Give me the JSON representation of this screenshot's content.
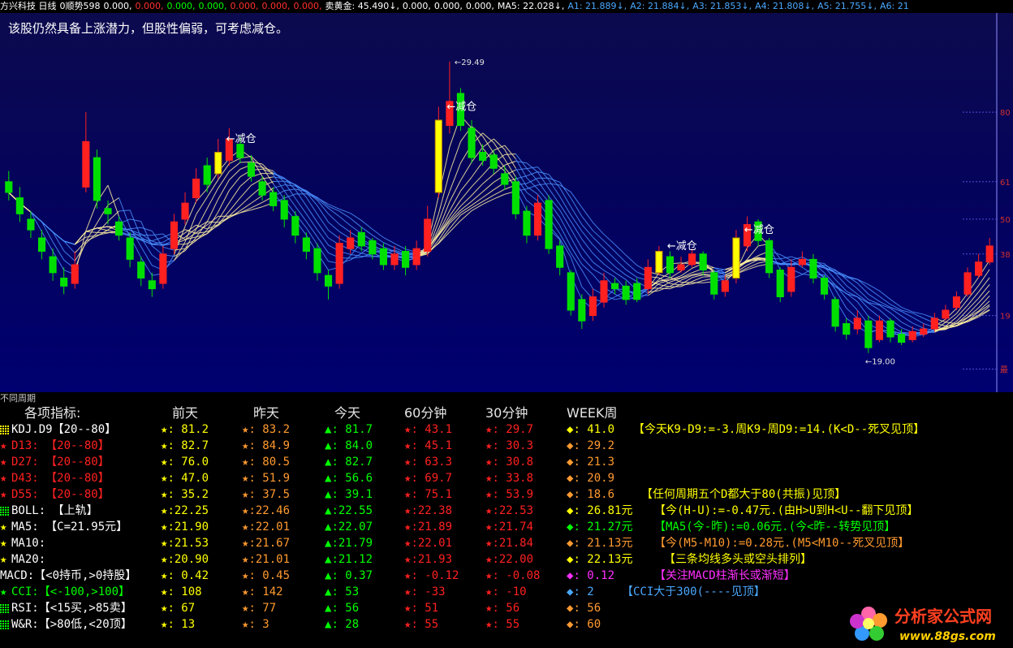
{
  "topbar": {
    "items": [
      {
        "text": "方兴科技 日线",
        "color": "#ffffff"
      },
      {
        "text": "0顺势598",
        "color": "#ffffff"
      },
      {
        "text": "0.000,",
        "color": "#ffffff"
      },
      {
        "text": "0.000,",
        "color": "#ff3030"
      },
      {
        "text": "0.000,",
        "color": "#00ff00"
      },
      {
        "text": "0.000,",
        "color": "#00ff00"
      },
      {
        "text": "0.000,",
        "color": "#ff3030"
      },
      {
        "text": "0.000,",
        "color": "#ff3030"
      },
      {
        "text": "0.000,",
        "color": "#ff3030"
      },
      {
        "text": "卖黄金: 45.490↓,",
        "color": "#ffffff"
      },
      {
        "text": "0.000,",
        "color": "#ffffff"
      },
      {
        "text": "0.000,",
        "color": "#ffffff"
      },
      {
        "text": "0.000,",
        "color": "#ffffff"
      },
      {
        "text": "MA5: 22.028↓,",
        "color": "#ffffff"
      },
      {
        "text": "A1: 21.889↓,",
        "color": "#4aa8ff"
      },
      {
        "text": "A2: 21.884↓,",
        "color": "#4aa8ff"
      },
      {
        "text": "A3: 21.853↓,",
        "color": "#4aa8ff"
      },
      {
        "text": "A4: 21.808↓,",
        "color": "#4aa8ff"
      },
      {
        "text": "A5: 21.755↓,",
        "color": "#4aa8ff"
      },
      {
        "text": "A6: 21",
        "color": "#4aa8ff"
      }
    ]
  },
  "chart_data": {
    "type": "candlestick",
    "title": "方兴科技 日线",
    "annotation": "该股仍然具备上涨潜力，但股性偏弱，可考虑减仓。",
    "signal_label": "←减仓",
    "signals_at_index": [
      19,
      39,
      59,
      66
    ],
    "max_label": "←29.49",
    "min_label": "←19.00",
    "y_axis_labels": [
      "80",
      "61",
      "50",
      "38",
      "19",
      "最"
    ],
    "ylim": [
      17.5,
      31.0
    ],
    "close": [
      24.6,
      23.8,
      23.2,
      22.4,
      21.6,
      21.1,
      21.9,
      26.5,
      24.3,
      23.8,
      23.0,
      22.1,
      21.4,
      21.0,
      22.3,
      23.5,
      24.2,
      25.1,
      24.9,
      26.1,
      26.6,
      25.9,
      25.2,
      24.5,
      24.1,
      23.6,
      23.0,
      22.4,
      21.6,
      21.1,
      22.7,
      22.9,
      22.6,
      22.3,
      21.9,
      22.3,
      21.8,
      22.5,
      23.6,
      27.3,
      28.0,
      27.1,
      25.9,
      25.8,
      25.5,
      24.9,
      23.8,
      23.0,
      24.2,
      22.5,
      21.8,
      20.2,
      19.8,
      20.7,
      21.3,
      21.0,
      20.6,
      20.6,
      21.8,
      22.4,
      21.6,
      21.9,
      22.3,
      21.7,
      20.8,
      21.3,
      22.9,
      23.4,
      22.8,
      21.6,
      20.7,
      21.8,
      22.1,
      21.4,
      20.8,
      19.6,
      19.3,
      19.9,
      18.8,
      19.8,
      19.2,
      19.0,
      19.4,
      19.5,
      19.9,
      20.2,
      20.7,
      21.6,
      22.0,
      22.6
    ],
    "open": [
      25.0,
      24.4,
      23.6,
      22.9,
      22.2,
      21.4,
      21.2,
      24.8,
      25.9,
      24.0,
      23.5,
      22.9,
      22.0,
      21.3,
      21.2,
      22.5,
      23.6,
      24.4,
      25.6,
      25.3,
      25.8,
      26.4,
      25.7,
      25.0,
      24.6,
      24.3,
      23.7,
      22.9,
      22.5,
      21.5,
      21.2,
      22.5,
      23.1,
      22.8,
      22.5,
      21.9,
      22.4,
      21.9,
      22.4,
      24.6,
      27.1,
      28.3,
      27.0,
      26.1,
      26.0,
      25.3,
      25.0,
      23.9,
      23.0,
      24.3,
      22.6,
      21.6,
      20.6,
      20.0,
      20.5,
      21.2,
      21.1,
      21.2,
      21.0,
      21.6,
      22.2,
      21.7,
      21.9,
      22.3,
      21.6,
      20.9,
      21.4,
      22.6,
      23.5,
      22.8,
      21.7,
      20.9,
      21.9,
      22.1,
      21.4,
      20.6,
      19.7,
      19.5,
      19.8,
      19.1,
      19.8,
      19.3,
      19.1,
      19.3,
      19.5,
      19.9,
      20.3,
      20.8,
      21.5,
      22.0
    ],
    "high": [
      25.4,
      24.8,
      23.9,
      23.2,
      22.5,
      21.8,
      22.4,
      27.6,
      26.2,
      24.3,
      23.7,
      23.1,
      22.2,
      21.6,
      22.6,
      23.8,
      24.6,
      25.5,
      25.9,
      26.6,
      27.0,
      26.7,
      26.0,
      25.2,
      24.8,
      24.5,
      23.9,
      23.1,
      22.7,
      21.7,
      23.0,
      23.2,
      23.3,
      22.9,
      22.7,
      22.6,
      22.6,
      22.8,
      24.1,
      27.8,
      29.49,
      28.5,
      27.3,
      26.4,
      26.2,
      25.6,
      25.2,
      24.1,
      24.5,
      24.5,
      22.8,
      21.7,
      20.8,
      21.0,
      21.6,
      21.4,
      21.3,
      21.4,
      22.1,
      22.6,
      22.4,
      22.2,
      22.5,
      22.4,
      21.7,
      21.5,
      23.2,
      23.7,
      23.6,
      22.9,
      21.8,
      22.1,
      22.4,
      22.3,
      21.5,
      20.7,
      19.9,
      20.2,
      20.0,
      20.0,
      19.9,
      19.5,
      19.6,
      19.7,
      20.1,
      20.4,
      20.9,
      21.8,
      22.3,
      22.9
    ],
    "low": [
      24.3,
      23.5,
      22.9,
      22.1,
      21.3,
      20.8,
      21.0,
      24.6,
      24.0,
      23.4,
      22.8,
      21.8,
      21.1,
      20.7,
      21.0,
      22.3,
      23.4,
      24.2,
      24.6,
      25.1,
      25.6,
      25.7,
      25.0,
      24.3,
      23.9,
      23.3,
      22.7,
      22.1,
      21.3,
      20.6,
      21.0,
      22.3,
      22.4,
      22.1,
      21.7,
      21.7,
      21.5,
      21.7,
      22.2,
      24.4,
      26.8,
      26.9,
      25.7,
      25.6,
      25.3,
      24.7,
      23.6,
      22.7,
      22.8,
      22.3,
      21.5,
      20.0,
      19.5,
      19.8,
      20.3,
      20.8,
      20.4,
      20.5,
      20.8,
      21.5,
      21.4,
      21.6,
      21.8,
      21.5,
      20.6,
      20.7,
      21.2,
      22.4,
      22.6,
      21.4,
      20.5,
      20.7,
      21.8,
      21.2,
      20.6,
      19.4,
      19.1,
      19.3,
      18.6,
      19.0,
      19.0,
      18.9,
      19.0,
      19.2,
      19.4,
      19.8,
      20.2,
      20.7,
      21.4,
      21.9
    ]
  },
  "panel": {
    "title": "不同周期",
    "headers": [
      "各项指标:",
      "前天",
      "昨天",
      "今天",
      "60分钟",
      "30分钟",
      "WEEK周"
    ],
    "rows": [
      {
        "ind": "KDJ.D9【20--80】",
        "ind_icon": "grid",
        "ind_color": "#ffff00",
        "vals": [
          [
            "★",
            "#ffff00",
            ": 81.2"
          ],
          [
            "★",
            "#ff9a30",
            ": 83.2"
          ],
          [
            "▲",
            "#00ff00",
            ": 81.7"
          ],
          [
            "★",
            "#ff2020",
            ": 43.1"
          ],
          [
            "★",
            "#ff2020",
            ": 29.7"
          ],
          [
            "◆",
            "#ffff00",
            ": 41.0"
          ]
        ],
        "note": "【今天K9-D9:=-3.周K9-周D9:=14.(K<D--死叉见顶】",
        "note_color": "#ffff00"
      },
      {
        "ind": "D13: 【20--80】",
        "ind_icon": "★",
        "ind_color": "#ff2020",
        "vals": [
          [
            "★",
            "#ffff00",
            ": 82.7"
          ],
          [
            "★",
            "#ff9a30",
            ": 84.9"
          ],
          [
            "▲",
            "#00ff00",
            ": 84.0"
          ],
          [
            "★",
            "#ff2020",
            ": 45.1"
          ],
          [
            "★",
            "#ff2020",
            ": 30.3"
          ],
          [
            "◆",
            "#ff9a30",
            ": 29.2"
          ]
        ],
        "note": "",
        "note_color": "#ffff00"
      },
      {
        "ind": "D27: 【20--80】",
        "ind_icon": "★",
        "ind_color": "#ff2020",
        "vals": [
          [
            "★",
            "#ffff00",
            ": 76.0"
          ],
          [
            "★",
            "#ff9a30",
            ": 80.5"
          ],
          [
            "▲",
            "#00ff00",
            ": 82.7"
          ],
          [
            "★",
            "#ff2020",
            ": 63.3"
          ],
          [
            "★",
            "#ff2020",
            ": 30.8"
          ],
          [
            "◆",
            "#ff9a30",
            ": 21.3"
          ]
        ],
        "note": "",
        "note_color": "#ffff00"
      },
      {
        "ind": "D43: 【20--80】",
        "ind_icon": "★",
        "ind_color": "#ff2020",
        "vals": [
          [
            "★",
            "#ffff00",
            ": 47.0"
          ],
          [
            "★",
            "#ff9a30",
            ": 51.9"
          ],
          [
            "▲",
            "#00ff00",
            ": 56.6"
          ],
          [
            "★",
            "#ff2020",
            ": 69.7"
          ],
          [
            "★",
            "#ff2020",
            ": 33.8"
          ],
          [
            "◆",
            "#ff9a30",
            ": 20.9"
          ]
        ],
        "note": "",
        "note_color": "#ffff00"
      },
      {
        "ind": "D55: 【20--80】",
        "ind_icon": "★",
        "ind_color": "#ff2020",
        "vals": [
          [
            "★",
            "#ffff00",
            ": 35.2"
          ],
          [
            "★",
            "#ff9a30",
            ": 37.5"
          ],
          [
            "▲",
            "#00ff00",
            ": 39.1"
          ],
          [
            "★",
            "#ff2020",
            ": 75.1"
          ],
          [
            "★",
            "#ff2020",
            ": 53.9"
          ],
          [
            "◆",
            "#ff9a30",
            ": 18.6"
          ]
        ],
        "note": "【任何周期五个D都大于80(共振)见顶】",
        "note_color": "#ffff00"
      },
      {
        "ind": "BOLL: 【上轨】",
        "ind_icon": "grid",
        "ind_color": "#00ff00",
        "vals": [
          [
            "★",
            "#ffff00",
            ":22.25"
          ],
          [
            "★",
            "#ff9a30",
            ":22.46"
          ],
          [
            "▲",
            "#00ff00",
            ":22.55"
          ],
          [
            "★",
            "#ff2020",
            ":22.38"
          ],
          [
            "★",
            "#ff2020",
            ":22.53"
          ],
          [
            "◆",
            "#ffff00",
            ": 26.81元"
          ]
        ],
        "note": "【今(H-U):=-0.47元.(由H>U到H<U--翻下见顶】",
        "note_color": "#ffff00"
      },
      {
        "ind": "MA5: 【C=21.95元】",
        "ind_icon": "★",
        "ind_color": "#ffff00",
        "vals": [
          [
            "★",
            "#ffff00",
            ":21.90"
          ],
          [
            "★",
            "#ff9a30",
            ":22.01"
          ],
          [
            "▲",
            "#00ff00",
            ":22.07"
          ],
          [
            "★",
            "#ff2020",
            ":21.89"
          ],
          [
            "★",
            "#ff2020",
            ":21.74"
          ],
          [
            "◆",
            "#00ff00",
            ": 21.27元"
          ]
        ],
        "note": "【MA5(今-昨):=0.06元.(今<昨--转势见顶】",
        "note_color": "#00ff00"
      },
      {
        "ind": "MA10:",
        "ind_icon": "★",
        "ind_color": "#ffff00",
        "vals": [
          [
            "★",
            "#ffff00",
            ":21.53"
          ],
          [
            "★",
            "#ff9a30",
            ":21.67"
          ],
          [
            "▲",
            "#00ff00",
            ":21.79"
          ],
          [
            "★",
            "#ff2020",
            ":22.01"
          ],
          [
            "★",
            "#ff2020",
            ":21.84"
          ],
          [
            "◆",
            "#ff9a30",
            ": 21.13元"
          ]
        ],
        "note": "【今(M5-M10):=0.28元.(M5<M10--死叉见顶】",
        "note_color": "#ff9a30"
      },
      {
        "ind": "MA20:",
        "ind_icon": "★",
        "ind_color": "#ffff00",
        "vals": [
          [
            "★",
            "#ffff00",
            ":20.90"
          ],
          [
            "★",
            "#ff9a30",
            ":21.01"
          ],
          [
            "▲",
            "#00ff00",
            ":21.12"
          ],
          [
            "★",
            "#ff2020",
            ":21.93"
          ],
          [
            "★",
            "#ff2020",
            ":22.00"
          ],
          [
            "◆",
            "#ffff00",
            ": 22.13元"
          ]
        ],
        "note": "【三条均线多头或空头排列】",
        "note_color": "#ffff00"
      },
      {
        "ind": "MACD:【<0持币,>0持股】",
        "ind_icon": "",
        "ind_color": "#ffffff",
        "vals": [
          [
            "★",
            "#ffff00",
            ": 0.42"
          ],
          [
            "★",
            "#ff9a30",
            ": 0.45"
          ],
          [
            "▲",
            "#00ff00",
            ": 0.37"
          ],
          [
            "★",
            "#ff2020",
            ": -0.12"
          ],
          [
            "★",
            "#ff2020",
            ": -0.08"
          ],
          [
            "◆",
            "#ff30ff",
            ": 0.12"
          ]
        ],
        "note": "【关注MACD柱渐长或渐短】",
        "note_color": "#ff30ff"
      },
      {
        "ind": "CCI:【<-100,>100】",
        "ind_icon": "★",
        "ind_color": "#00ff00",
        "vals": [
          [
            "★",
            "#ffff00",
            ": 108"
          ],
          [
            "★",
            "#ff9a30",
            ": 142"
          ],
          [
            "▲",
            "#00ff00",
            ": 53"
          ],
          [
            "★",
            "#ff2020",
            ": -33"
          ],
          [
            "★",
            "#ff2020",
            ": -10"
          ],
          [
            "◆",
            "#4aa8ff",
            ": 2"
          ]
        ],
        "note": "【CCI大于300(----见顶】",
        "note_color": "#4aa8ff"
      },
      {
        "ind": "RSI:【<15买,>85卖】",
        "ind_icon": "grid",
        "ind_color": "#00ff00",
        "vals": [
          [
            "★",
            "#ffff00",
            ": 67"
          ],
          [
            "★",
            "#ff9a30",
            ": 77"
          ],
          [
            "▲",
            "#00ff00",
            ": 56"
          ],
          [
            "★",
            "#ff2020",
            ": 51"
          ],
          [
            "★",
            "#ff2020",
            ": 56"
          ],
          [
            "◆",
            "#ff9a30",
            ": 56"
          ]
        ],
        "note": "",
        "note_color": "#ffff00"
      },
      {
        "ind": "W&R:【>80低,<20顶】",
        "ind_icon": "grid",
        "ind_color": "#00ff00",
        "vals": [
          [
            "★",
            "#ffff00",
            ": 13"
          ],
          [
            "★",
            "#ff9a30",
            ": 3"
          ],
          [
            "▲",
            "#00ff00",
            ": 28"
          ],
          [
            "★",
            "#ff2020",
            ": 55"
          ],
          [
            "★",
            "#ff2020",
            ": 55"
          ],
          [
            "◆",
            "#ff9a30",
            ": 60"
          ]
        ],
        "note": "",
        "note_color": "#ffff00"
      }
    ]
  },
  "logo": {
    "name": "分析家公式网",
    "url": "www.88gs.com"
  },
  "colors": {
    "up": "#ff2020",
    "down": "#00e000",
    "signal": "#ffff00",
    "ribbon_up": "#fff0a0",
    "ribbon_down": "#4a90ff"
  }
}
